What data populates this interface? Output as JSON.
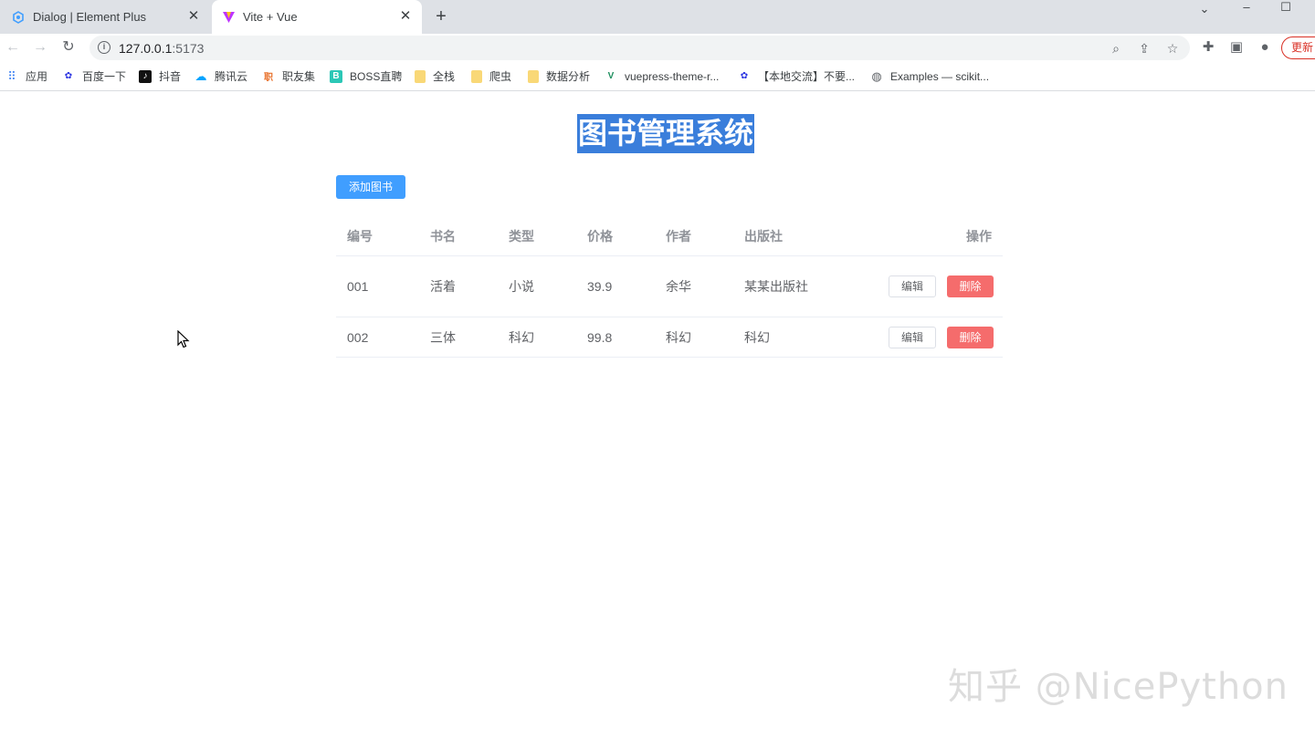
{
  "browser": {
    "tabs": [
      {
        "title": "Dialog | Element Plus",
        "active": false
      },
      {
        "title": "Vite + Vue",
        "active": true
      }
    ],
    "new_tab": "+",
    "address": {
      "host": "127.0.0.1",
      "port": ":5173"
    },
    "update_label": "更新",
    "bookmarks": [
      "应用",
      "百度一下",
      "抖音",
      "腾讯云",
      "职友集",
      "BOSS直聘",
      "全栈",
      "爬虫",
      "数据分析",
      "vuepress-theme-r...",
      "【本地交流】不要...",
      "Examples — scikit..."
    ]
  },
  "page": {
    "title": "图书管理系统",
    "add_button": "添加图书",
    "table": {
      "headers": [
        "编号",
        "书名",
        "类型",
        "价格",
        "作者",
        "出版社",
        "操作"
      ],
      "rows": [
        {
          "id": "001",
          "name": "活着",
          "type": "小说",
          "price": "39.9",
          "author": "余华",
          "publisher": "某某出版社"
        },
        {
          "id": "002",
          "name": "三体",
          "type": "科幻",
          "price": "99.8",
          "author": "科幻",
          "publisher": "科幻"
        }
      ],
      "edit_label": "编辑",
      "delete_label": "删除"
    }
  },
  "watermark": "知乎 @NicePython",
  "colors": {
    "primary": "#409eff",
    "danger": "#f56c6c",
    "title_highlight": "#3a7edb"
  }
}
